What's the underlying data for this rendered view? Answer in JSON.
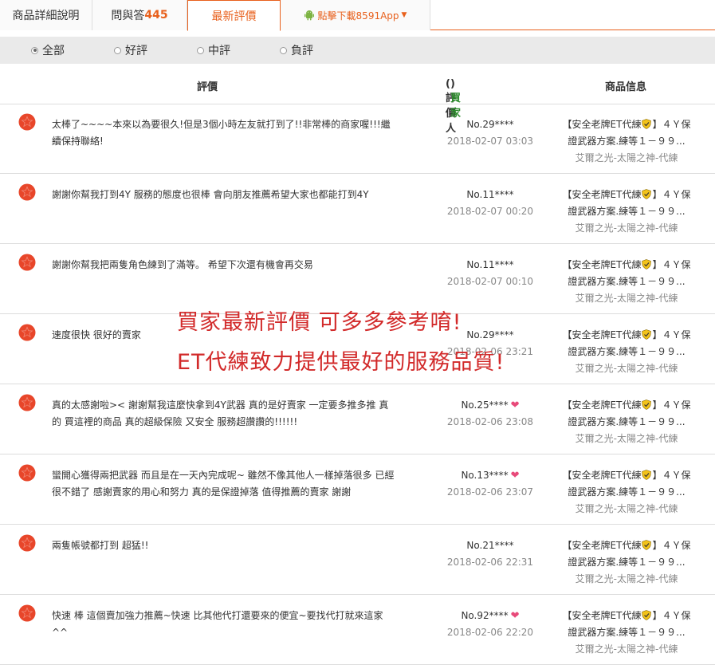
{
  "tabs": [
    {
      "label": "商品詳細說明",
      "count": ""
    },
    {
      "label": "問與答",
      "count": "445"
    },
    {
      "label": "最新評價",
      "count": ""
    },
    {
      "label": "點擊下載8591App",
      "count": ""
    }
  ],
  "filters": [
    {
      "label": "全部",
      "selected": true
    },
    {
      "label": "好評",
      "selected": false
    },
    {
      "label": "中評",
      "selected": false
    },
    {
      "label": "負評",
      "selected": false
    }
  ],
  "table_header": {
    "review": "評價",
    "reviewer": "評價人",
    "buyer_tag": "買家",
    "product": "商品信息"
  },
  "rows": [
    {
      "comment": "太棒了~~~~本來以為要很久!但是3個小時左友就打到了!!非常棒的商家喔!!!繼續保持聯絡!",
      "reviewer": "No.29****",
      "heart": false,
      "date": "2018-02-07 03:03",
      "product_title": "【安全老牌ET代練",
      "product_title2": "】４Ｙ保證武器方案.練等１－９９...",
      "server": "艾爾之光-太陽之神-代練"
    },
    {
      "comment": "謝謝你幫我打到4Y 服務的態度也很棒 會向朋友推薦希望大家也都能打到4Y",
      "reviewer": "No.11****",
      "heart": false,
      "date": "2018-02-07 00:20",
      "product_title": "【安全老牌ET代練",
      "product_title2": "】４Ｙ保證武器方案.練等１－９９...",
      "server": "艾爾之光-太陽之神-代練"
    },
    {
      "comment": "謝謝你幫我把兩隻角色練到了滿等。 希望下次還有機會再交易",
      "reviewer": "No.11****",
      "heart": false,
      "date": "2018-02-07 00:10",
      "product_title": "【安全老牌ET代練",
      "product_title2": "】４Ｙ保證武器方案.練等１－９９...",
      "server": "艾爾之光-太陽之神-代練"
    },
    {
      "comment": "速度很快 很好的賣家",
      "reviewer": "No.29****",
      "heart": false,
      "date": "2018-02-06 23:21",
      "product_title": "【安全老牌ET代練",
      "product_title2": "】４Ｙ保證武器方案.練等１－９９...",
      "server": "艾爾之光-太陽之神-代練"
    },
    {
      "comment": "真的太感謝啦>< 謝謝幫我這麼快拿到4Y武器 真的是好賣家 一定要多推多推 真的 買這裡的商品 真的超級保險 又安全 服務超讚讚的!!!!!!",
      "reviewer": "No.25****",
      "heart": true,
      "date": "2018-02-06 23:08",
      "product_title": "【安全老牌ET代練",
      "product_title2": "】４Ｙ保證武器方案.練等１－９９...",
      "server": "艾爾之光-太陽之神-代練"
    },
    {
      "comment": "蠻開心獲得兩把武器 而且是在一天內完成呢~ 雖然不像其他人一樣掉落很多 已經很不錯了 感謝賣家的用心和努力 真的是保證掉落 值得推薦的賣家 謝謝",
      "reviewer": "No.13****",
      "heart": true,
      "date": "2018-02-06 23:07",
      "product_title": "【安全老牌ET代練",
      "product_title2": "】４Ｙ保證武器方案.練等１－９９...",
      "server": "艾爾之光-太陽之神-代練"
    },
    {
      "comment": "兩隻帳號都打到 超猛!!",
      "reviewer": "No.21****",
      "heart": false,
      "date": "2018-02-06 22:31",
      "product_title": "【安全老牌ET代練",
      "product_title2": "】４Ｙ保證武器方案.練等１－９９...",
      "server": "艾爾之光-太陽之神-代練"
    },
    {
      "comment": "快速 棒 這個賣加強力推薦~快速 比其他代打還要來的便宜~要找代打就來這家 ^^",
      "reviewer": "No.92****",
      "heart": true,
      "date": "2018-02-06 22:20",
      "product_title": "【安全老牌ET代練",
      "product_title2": "】４Ｙ保證武器方案.練等１－９９...",
      "server": "艾爾之光-太陽之神-代練"
    }
  ],
  "overlay": {
    "line1": "買家最新評價 可多多參考唷!",
    "line2": "ET代練致力提供最好的服務品質!"
  },
  "colors": {
    "accent": "#e8601c",
    "star": "#e8462a",
    "heart": "#e84a7a",
    "buyer": "#2a8a2a",
    "overlay": "#d22a2a"
  }
}
